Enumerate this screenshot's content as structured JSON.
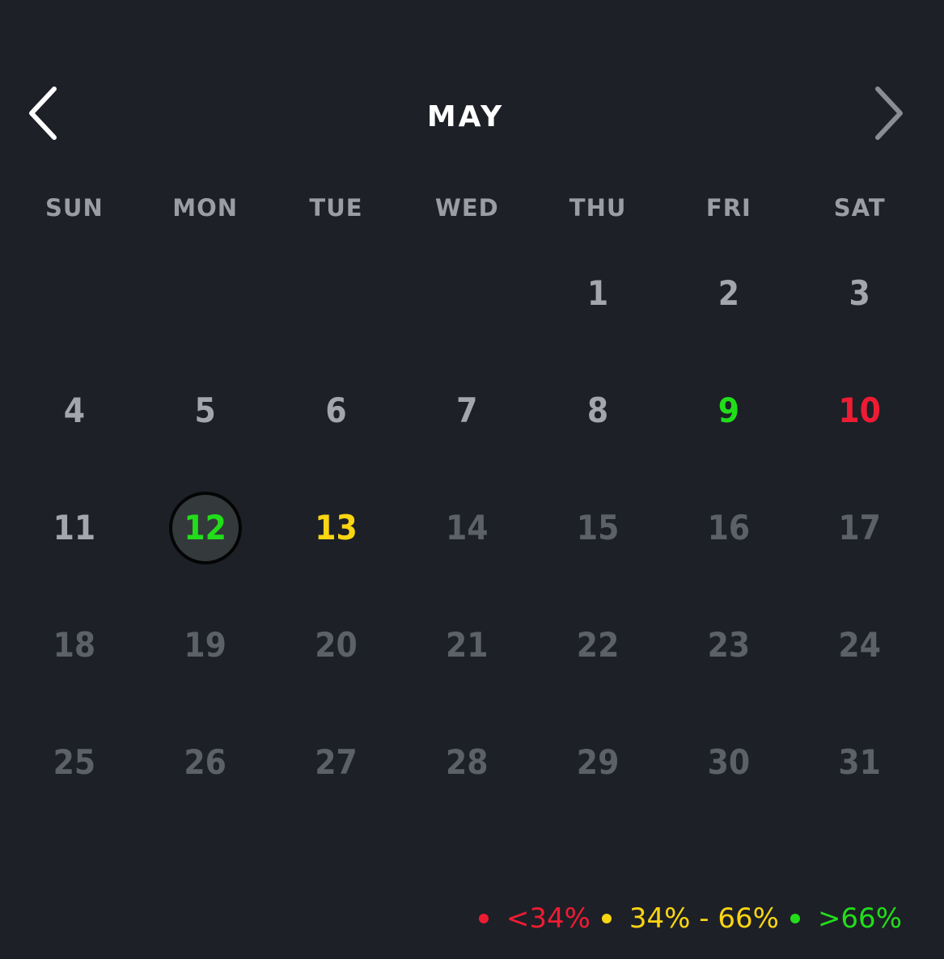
{
  "header": {
    "month": "MAY",
    "prev_icon": "chevron-left-icon",
    "next_icon": "chevron-right-icon"
  },
  "weekdays": [
    "SUN",
    "MON",
    "TUE",
    "WED",
    "THU",
    "FRI",
    "SAT"
  ],
  "days": [
    "",
    "",
    "",
    "",
    "1",
    "2",
    "3",
    "4",
    "5",
    "6",
    "7",
    "8",
    "9",
    "10",
    "11",
    "12",
    "13",
    "14",
    "15",
    "16",
    "17",
    "18",
    "19",
    "20",
    "21",
    "22",
    "23",
    "24",
    "25",
    "26",
    "27",
    "28",
    "29",
    "30",
    "31"
  ],
  "selected_day": "12",
  "highlighted_days": {
    "9": "green",
    "10": "red",
    "12": "green",
    "13": "yellow"
  },
  "past_through_day": 13,
  "colors": {
    "background": "#1d2027",
    "red": "#ee1c33",
    "yellow": "#fad512",
    "green": "#22dd1a",
    "past_text": "#a3a6ac",
    "future_text": "#5c6068"
  },
  "legend": [
    {
      "label": "<34%",
      "color": "red"
    },
    {
      "label": "34% - 66%",
      "color": "yellow"
    },
    {
      "label": ">66%",
      "color": "green"
    }
  ]
}
